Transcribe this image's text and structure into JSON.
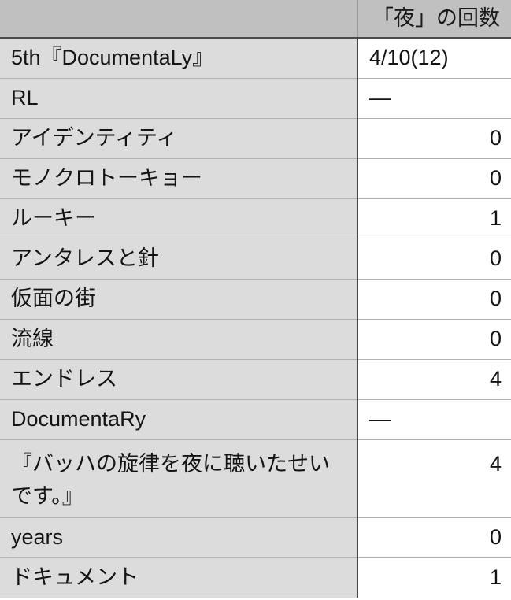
{
  "table": {
    "columns": [
      {
        "key": "title",
        "label": "",
        "align": "left"
      },
      {
        "key": "value",
        "label": "「夜」の回数",
        "align": "right"
      }
    ],
    "header": {
      "title_label": "",
      "value_label": "「夜」の回数"
    },
    "rows": [
      {
        "title": "5th『DocumentaLy』",
        "value": "4/10(12)",
        "value_align": "left",
        "lines": 1
      },
      {
        "title": "RL",
        "value": "—",
        "value_align": "left",
        "lines": 1
      },
      {
        "title": "アイデンティティ",
        "value": "0",
        "value_align": "right",
        "lines": 1
      },
      {
        "title": "モノクロトーキョー",
        "value": "0",
        "value_align": "right",
        "lines": 1
      },
      {
        "title": "ルーキー",
        "value": "1",
        "value_align": "right",
        "lines": 1
      },
      {
        "title": "アンタレスと針",
        "value": "0",
        "value_align": "right",
        "lines": 1
      },
      {
        "title": "仮面の街",
        "value": "0",
        "value_align": "right",
        "lines": 1
      },
      {
        "title": "流線",
        "value": "0",
        "value_align": "right",
        "lines": 1
      },
      {
        "title": "エンドレス",
        "value": "4",
        "value_align": "right",
        "lines": 1
      },
      {
        "title": "DocumentaRy",
        "value": "—",
        "value_align": "left",
        "lines": 1
      },
      {
        "title": "『バッハの旋律を夜に聴いたせいです。』",
        "value": "4",
        "value_align": "right",
        "lines": 2
      },
      {
        "title": "years",
        "value": "0",
        "value_align": "right",
        "lines": 1
      },
      {
        "title": "ドキュメント",
        "value": "1",
        "value_align": "right",
        "lines": 1
      }
    ]
  },
  "colors": {
    "header_bg": "#c0c0c0",
    "row_title_bg": "#dcdcdc",
    "row_value_bg": "#ffffff",
    "text": "#141414",
    "divider_strong": "#4a4a4a",
    "divider_light": "#b3b3b3"
  }
}
